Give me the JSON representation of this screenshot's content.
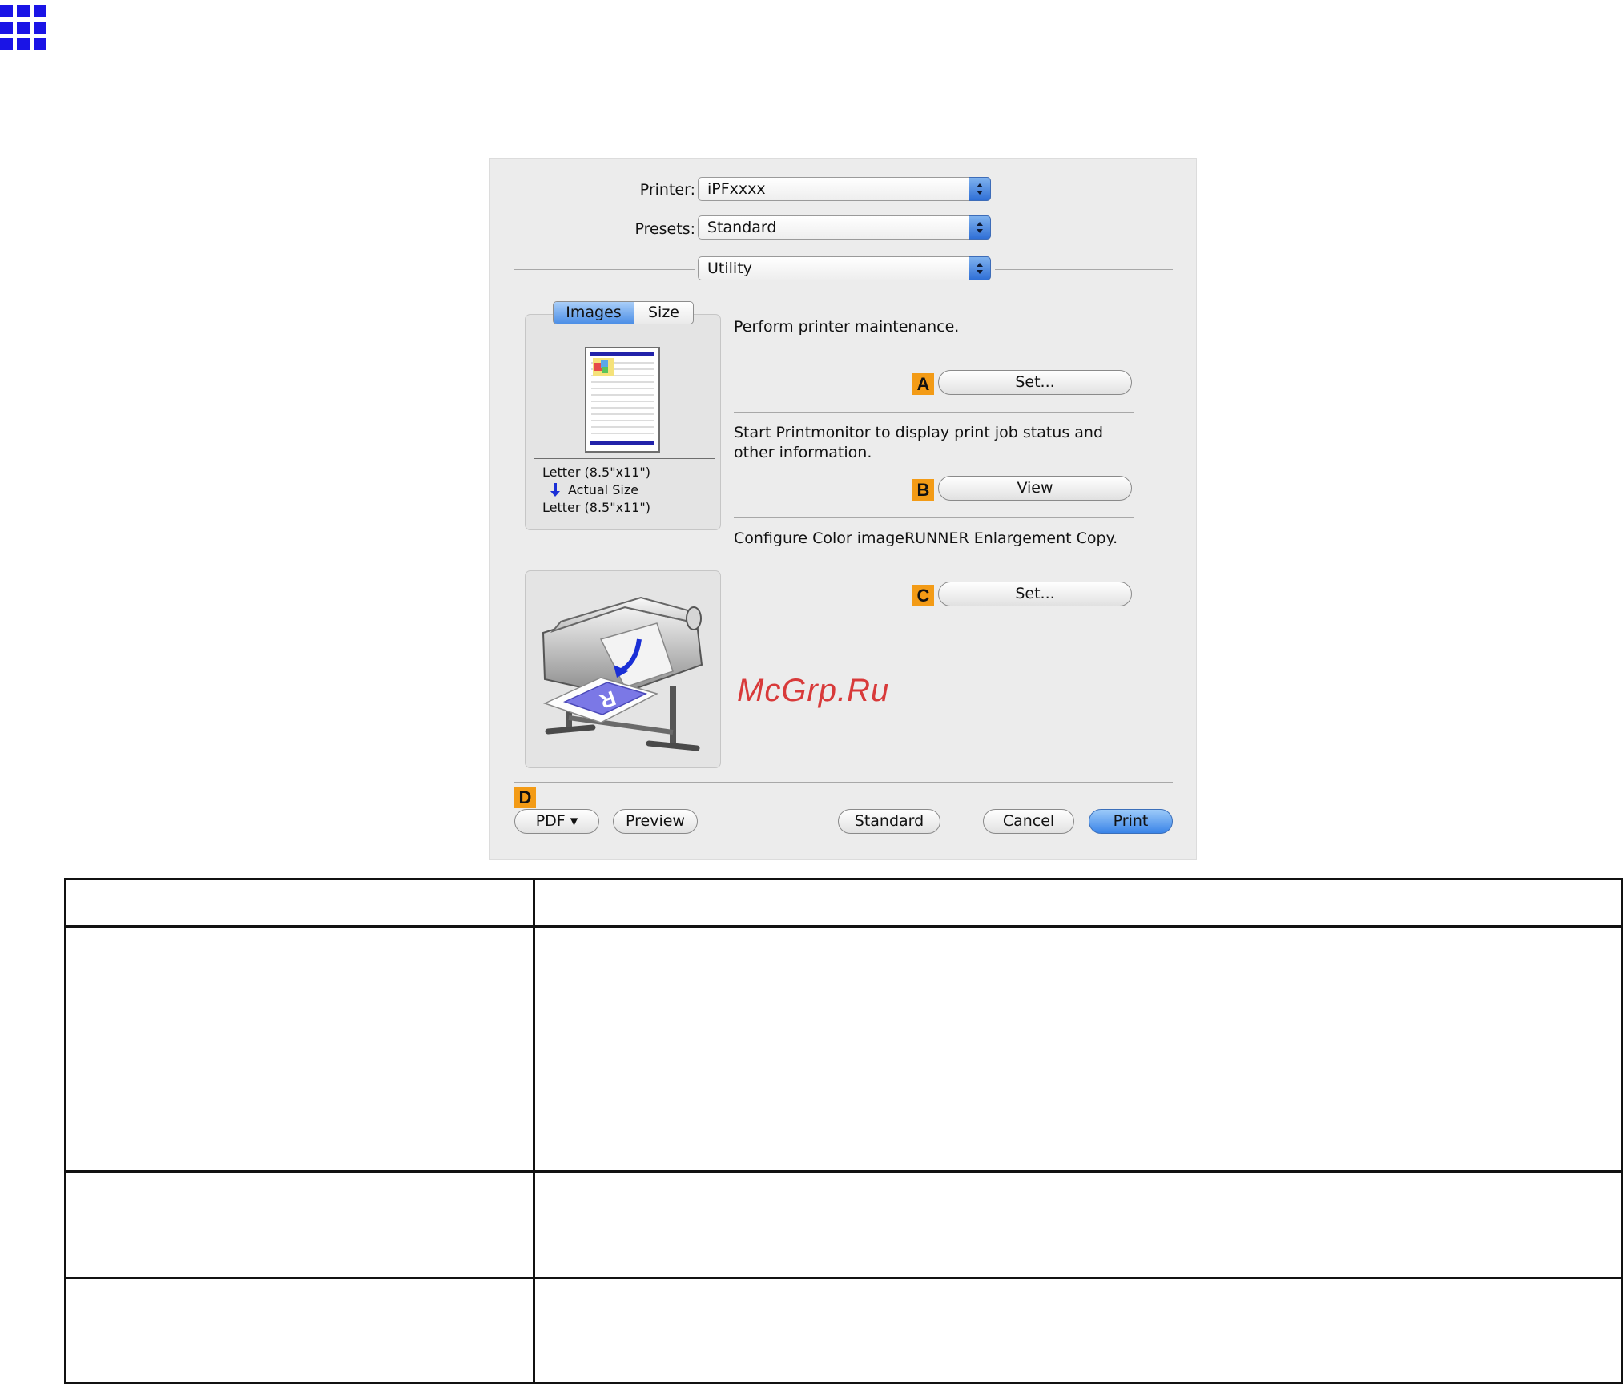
{
  "dialog": {
    "printer_label": "Printer:",
    "printer_value": "iPFxxxx",
    "presets_label": "Presets:",
    "presets_value": "Standard",
    "pane_value": "Utility",
    "preview_tabs": [
      "Images",
      "Size"
    ],
    "paper_info": {
      "line1": "Letter (8.5\"x11\")",
      "line2": "Actual Size",
      "line3": "Letter (8.5\"x11\")"
    },
    "sections": [
      {
        "description": "Perform printer maintenance.",
        "badge": "A",
        "button": "Set..."
      },
      {
        "description": "Start Printmonitor to display print job status and other information.",
        "badge": "B",
        "button": "View"
      },
      {
        "description": "Configure Color imageRUNNER Enlargement Copy.",
        "badge": "C",
        "button": "Set..."
      }
    ],
    "footer": {
      "badge": "D",
      "pdf_label": "PDF ▾",
      "preview_label": "Preview",
      "standard_label": "Standard",
      "cancel_label": "Cancel",
      "print_label": "Print"
    }
  },
  "watermark": "McGrp.Ru",
  "colors": {
    "accent_blue": "#3a84e8",
    "badge_orange": "#f39b16",
    "logo_blue": "#1a14e6",
    "watermark_red": "#d83a3a"
  },
  "icons": [
    "grid-logo-icon",
    "popup-stepper-icon",
    "printer-illustration-icon",
    "page-thumbnail-icon",
    "down-arrow-icon"
  ]
}
